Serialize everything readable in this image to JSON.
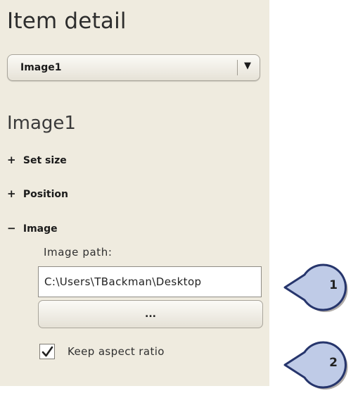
{
  "panel": {
    "title": "Item detail",
    "item_selector": {
      "value": "Image1",
      "arrow": "▼"
    },
    "section_title": "Image1",
    "groups": [
      {
        "sign": "+",
        "label": "Set size",
        "expanded": false
      },
      {
        "sign": "+",
        "label": "Position",
        "expanded": false
      },
      {
        "sign": "−",
        "label": "Image",
        "expanded": true
      }
    ],
    "image_group": {
      "path_label": "Image path:",
      "path_value": "C:\\Users\\TBackman\\Desktop",
      "browse_label": "...",
      "keep_aspect_label": "Keep aspect ratio",
      "keep_aspect_checked": true
    }
  },
  "callouts": [
    {
      "number": "1"
    },
    {
      "number": "2"
    }
  ],
  "colors": {
    "panel_bg": "#efebdf",
    "callout_fill": "#bfcbe7",
    "callout_stroke": "#26356c"
  }
}
